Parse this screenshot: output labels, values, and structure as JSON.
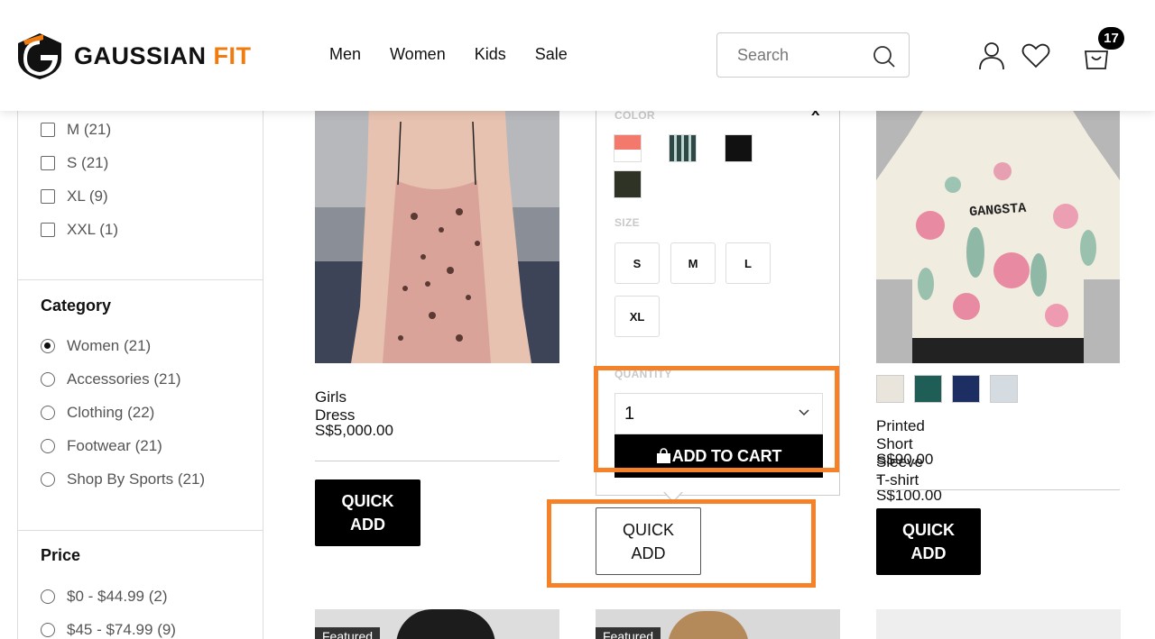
{
  "brand": {
    "name_part1": "GAUSSIAN ",
    "name_part2": "FIT"
  },
  "nav": {
    "items": [
      "Men",
      "Women",
      "Kids",
      "Sale"
    ]
  },
  "search": {
    "placeholder": "Search"
  },
  "cart": {
    "count": "17"
  },
  "sidebar": {
    "sizes": [
      {
        "label": "M (21)"
      },
      {
        "label": "S (21)"
      },
      {
        "label": "XL (9)"
      },
      {
        "label": "XXL (1)"
      }
    ],
    "category": {
      "heading": "Category",
      "items": [
        {
          "label": "Women (21)",
          "checked": true
        },
        {
          "label": "Accessories (21)",
          "checked": false
        },
        {
          "label": "Clothing (22)",
          "checked": false
        },
        {
          "label": "Footwear (21)",
          "checked": false
        },
        {
          "label": "Shop By Sports (21)",
          "checked": false
        }
      ]
    },
    "price": {
      "heading": "Price",
      "items": [
        {
          "label": "$0 - $44.99 (2)"
        },
        {
          "label": "$45 - $74.99 (9)"
        }
      ]
    }
  },
  "products": [
    {
      "name": "Girls Dress",
      "price": "S$5,000.00",
      "quick_add_line1": "QUICK",
      "quick_add_line2": "ADD"
    },
    {
      "quick_add_line1": "QUICK",
      "quick_add_line2": "ADD"
    },
    {
      "name": "Printed Short Sleeve T-shirt",
      "price": "S$90.00 - S$100.00",
      "quick_add_line1": "QUICK",
      "quick_add_line2": "ADD",
      "shirt_text": "GANGSTA"
    }
  ],
  "quick_add_popover": {
    "color_label": "COLOR",
    "close_label": "x",
    "colors": [
      "#f2796b",
      "#3d5a5a",
      "#111111",
      "#2e3326"
    ],
    "size_label": "SIZE",
    "sizes": [
      "S",
      "M",
      "L",
      "XL"
    ],
    "quantity_label": "QUANTITY",
    "quantity_value": "1",
    "add_to_cart_label": "ADD TO CART"
  },
  "bottom_row": {
    "tag1": "Featured",
    "tag2": "Featured"
  },
  "colors": {
    "accent": "#f07c0f",
    "highlight": "#f58228"
  }
}
